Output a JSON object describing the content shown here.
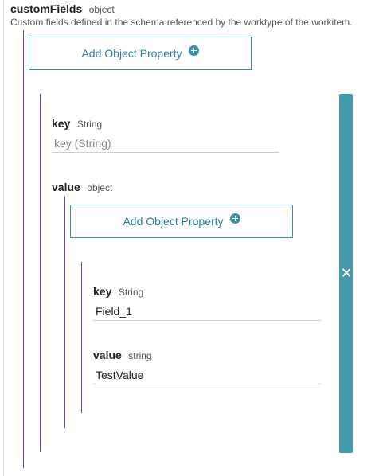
{
  "custom_fields": {
    "name": "customFields",
    "type": "object",
    "description": "Custom fields defined in the schema referenced by the worktype of the workitem.",
    "add_button_label": "Add Object Property"
  },
  "entry": {
    "key": {
      "name": "key",
      "type": "String",
      "placeholder": "key (String)",
      "value": ""
    },
    "value": {
      "name": "value",
      "type": "object",
      "add_button_label": "Add Object Property",
      "nested": {
        "key": {
          "name": "key",
          "type": "String",
          "value": "Field_1"
        },
        "value": {
          "name": "value",
          "type": "string",
          "value": "TestValue"
        }
      }
    }
  },
  "colors": {
    "accent": "#3d8fa4",
    "remove_bar": "#4499ad",
    "tree_line": "#7c3aed"
  },
  "icons": {
    "add": "plus-circle-icon",
    "remove": "close-icon"
  }
}
